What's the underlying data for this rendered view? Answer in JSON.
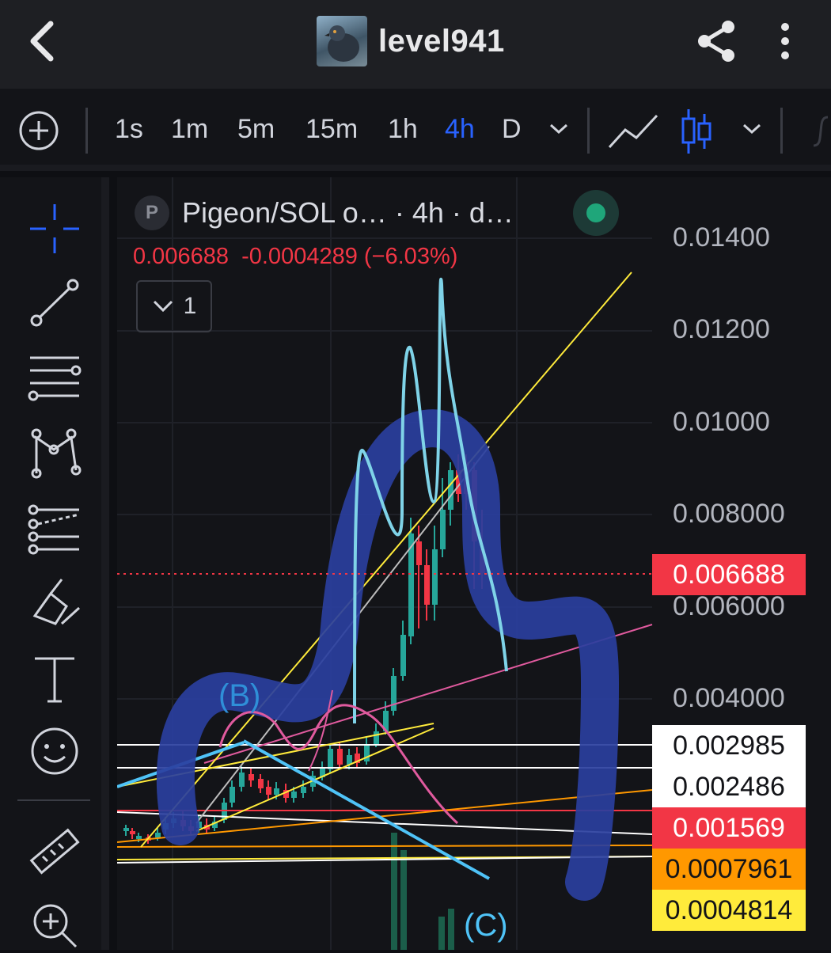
{
  "header": {
    "username": "level941",
    "back_icon": "back-chevron-icon",
    "share_icon": "share-icon",
    "more_icon": "more-vertical-icon"
  },
  "toolbar": {
    "intervals": [
      "1s",
      "1m",
      "5m",
      "15m",
      "1h",
      "4h",
      "D"
    ],
    "active_interval": "4h",
    "icons": [
      "add-circle-icon",
      "dropdown-chevron-icon",
      "line-chart-icon",
      "candles-icon",
      "dropdown-chevron-icon"
    ]
  },
  "sidebar": {
    "tools": [
      "crosshair-icon",
      "trendline-icon",
      "horizontal-lines-icon",
      "pattern-icon",
      "fib-icon",
      "brush-icon",
      "text-icon",
      "emoji-icon",
      "ruler-icon",
      "zoom-in-icon"
    ]
  },
  "chart": {
    "badge": "P",
    "title": "Pigeon/SOL o… · 4h · d…",
    "last": "0.006688",
    "change": "-0.0004289",
    "change_pct": "(−6.03%)",
    "collapse_count": "1",
    "colors": {
      "up": "#26a69a",
      "down": "#f23645",
      "accent": "#2962ff",
      "status": "#1fa67a"
    }
  },
  "chart_data": {
    "type": "candlestick",
    "title": "Pigeon/SOL o… · 4h · d…",
    "y_axis_ticks": [
      "0.01400",
      "0.01200",
      "0.01000",
      "0.008000",
      "0.006000",
      "0.004000"
    ],
    "ylim": [
      0.0002,
      0.0146
    ],
    "price_tags": [
      {
        "value": "0.006688",
        "bg": "#f23645",
        "fg": "#ffffff"
      },
      {
        "value": "0.002985",
        "bg": "#ffffff",
        "fg": "#131418"
      },
      {
        "value": "0.002486",
        "bg": "#ffffff",
        "fg": "#131418"
      },
      {
        "value": "0.001569",
        "bg": "#f23645",
        "fg": "#ffffff"
      },
      {
        "value": "0.0007961",
        "bg": "#ff9800",
        "fg": "#131418"
      },
      {
        "value": "0.0004814",
        "bg": "#ffeb3b",
        "fg": "#131418"
      }
    ],
    "annotations": [
      "(B)",
      "(C)"
    ]
  }
}
